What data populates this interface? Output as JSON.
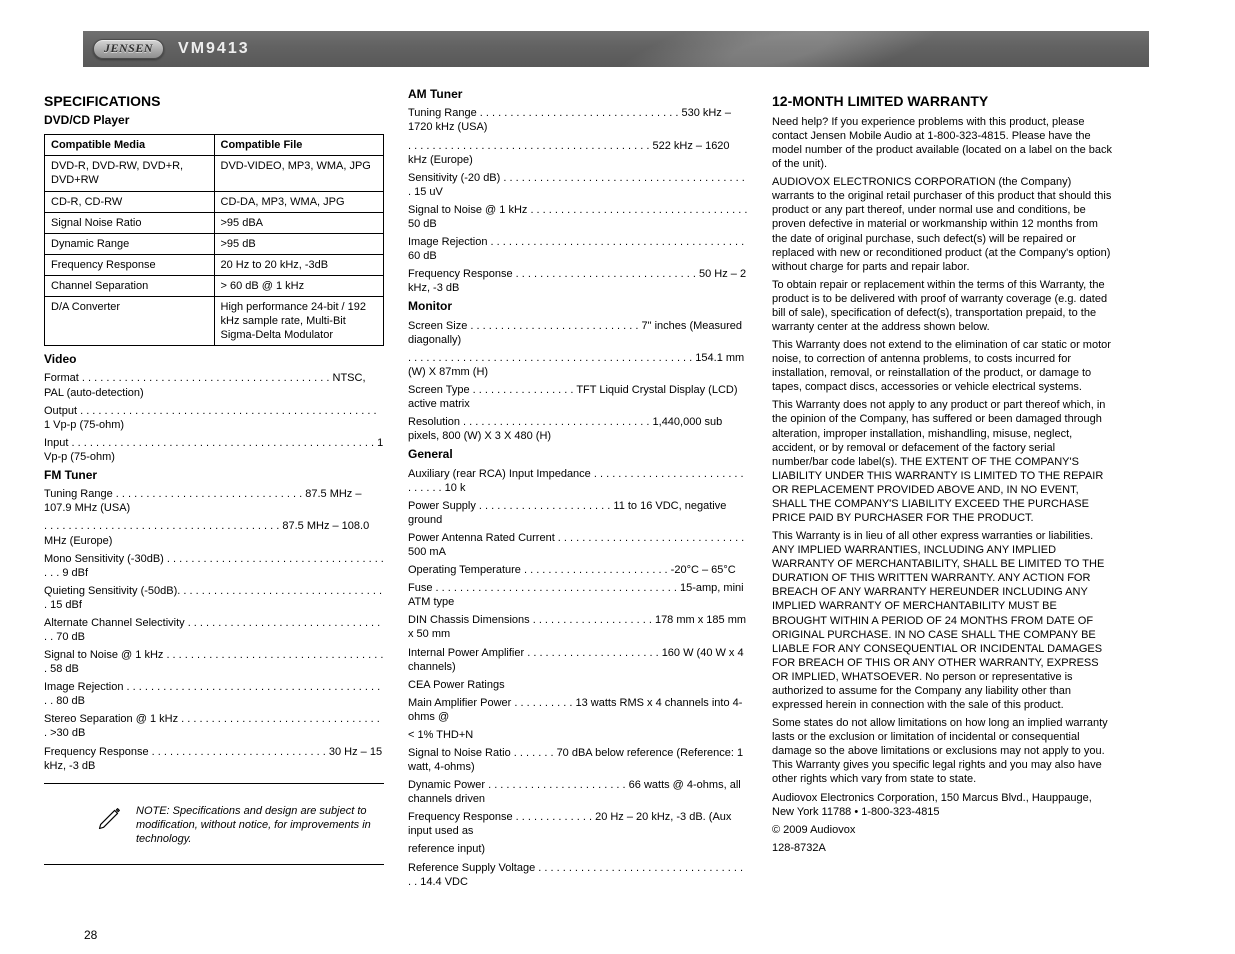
{
  "header": {
    "brand": "JENSEN",
    "model": "VM9413"
  },
  "col1": {
    "h1_a": "SPECIFICATIONS",
    "h1_b": "DVD/CD Player",
    "table": {
      "h1": "Compatible Media",
      "h2": "Compatible File",
      "row1a": "DVD-R, DVD-RW, DVD+R, DVD+RW",
      "row1b": "DVD-VIDEO, MP3, WMA, JPG",
      "row2a": "CD-R, CD-RW",
      "row2b": "CD-DA, MP3, WMA, JPG",
      "row3a": "Signal Noise Ratio",
      "row3b": ">95 dBA",
      "row4a": "Dynamic Range",
      "row4b": ">95 dB",
      "row5a": "Frequency Response",
      "row5b": "20 Hz to 20 kHz, -3dB",
      "row6a": "Channel Separation",
      "row6b": "> 60 dB @ 1 kHz",
      "row7a": "D/A Converter",
      "row7b": "High performance 24-bit / 192 kHz sample rate, Multi-Bit Sigma-Delta Modulator"
    },
    "video_h": "Video",
    "video": [
      "Format . . . . . . . . . . . . . . . . . . . . . . . . . . . . . . . . . . . . . . . . .  NTSC, PAL (auto-detection)",
      "Output . . . . . . . . . . . . . . . . . . . . . . . . . . . . . . . . . . . . . . . . . . . . . . . . .  1 Vp-p (75-ohm)",
      "Input . . . . . . . . . . . . . . . . . . . . . . . . . . . . . . . . . . . . . . . . . . . . . . . . . .  1 Vp-p (75-ohm)"
    ],
    "fm_h": "FM Tuner",
    "fm": [
      "Tuning Range  . . . . . . . . . . . . . . . . . . . . . . . . . . . . . . .  87.5 MHz – 107.9 MHz (USA)",
      ". . . . . . . . . . . . . . . . . . . . . . . . . . . . . . . . . . . . . . .  87.5 MHz – 108.0 MHz (Europe)",
      "Mono Sensitivity (-30dB) . . . . . . . . . . . . . . . . . . . . . . . . . . . . . . . . . . . . . . .  9 dBf",
      "Quieting Sensitivity (-50dB). . . . . . . . . . . . . . . . . . . . . . . . . . . . . . . . . . .  15 dBf",
      "Alternate Channel Selectivity . . . . . . . . . . . . . . . . . . . . . . . . . . . . . . . . . .  70 dB",
      "Signal to Noise @ 1 kHz . . . . . . . . . . . . . . . . . . . . . . . . . . . . . . . . . . . . .  58 dB",
      "Image Rejection . . . . . . . . . . . . . . . . . . . . . . . . . . . . . . . . . . . . . . . . . . . .  80 dB",
      "Stereo Separation @ 1 kHz  . . . . . . . . . . . . . . . . . . . . . . . . . . . . . . . . . .  >30 dB",
      "Frequency Response  . . . . . . . . . . . . . . . . . . . . . . . . . . . . .  30 Hz – 15 kHz, -3 dB"
    ],
    "note": "NOTE:   Specifications and design are subject to modification, without notice, for improvements in technology."
  },
  "col2": {
    "am_h": "AM Tuner",
    "am": [
      "Tuning Range  . . . . . . . . . . . . . . . . . . . . . . . . . . . . . . . . .  530 kHz – 1720 kHz (USA)",
      ". . . . . . . . . . . . . . . . . . . . . . . . . . . . . . . . . . . . . . . .  522 kHz – 1620 kHz (Europe)",
      "Sensitivity (-20 dB) . . . . . . . . . . . . . . . . . . . . . . . . . . . . . . . . . . . . . . . . .  15 uV",
      "Signal to Noise @ 1 kHz . . . . . . . . . . . . . . . . . . . . . . . . . . . . . . . . . . . .  50 dB",
      "Image Rejection . . . . . . . . . . . . . . . . . . . . . . . . . . . . . . . . . . . . . . . . . .  60 dB",
      "Frequency Response  . . . . . . . . . . . . . . . . . . . . . . . . . . . . . .  50 Hz – 2 kHz, -3 dB"
    ],
    "mon_h": "Monitor",
    "mon": [
      "Screen Size  . . . . . . . . . . . . . . . . . . . . . . . . . . . .  7\" inches (Measured diagonally)",
      ". . . . . . . . . . . . . . . . . . . . . . . . . . . . . . . . . . . . . . . . . . . . . . .  154.1 mm (W) X 87mm (H)",
      "Screen Type . . . . . . . . . . . . . . . . .  TFT Liquid Crystal Display (LCD) active matrix",
      "Resolution . . . . . . . . . . . . . . . . . . . . . . . . . . . . . . . 1,440,000 sub pixels, 800 (W) X 3 X 480 (H)"
    ],
    "gen_h": "General",
    "gen": [
      "Auxiliary (rear RCA) Input Impedance . . . . . . . . . . . . . . . . . . . . . . . . . . . . . . . 10 k",
      "Power Supply  . . . . . . . . . . . . . . . . . . . . . .  11 to 16 VDC, negative ground",
      "Power Antenna Rated Current . . . . . . . . . . . . . . . . . . . . . . . . . . . . . . . 500 mA",
      "Operating Temperature  . . . . . . . . . . . . . . . . . . . . . . . .  -20°C – 65°C",
      "Fuse  . . . . . . . . . . . . . . . . . . . . . . . . . . . . . . . . . . . . . . . .  15-amp, mini ATM type",
      "DIN Chassis Dimensions . . . . . . . . . . . . . . . . . . . .  178 mm x 185 mm x 50 mm",
      "Internal Power Amplifier . . . . . . . . . . . . . . . . . . . . . .  160 W (40 W x 4 channels)",
      "CEA Power Ratings",
      "Main Amplifier Power  . . . . . . . . . .  13 watts RMS x 4 channels into 4-ohms @",
      "   < 1% THD+N",
      "Signal to Noise Ratio  . . . . . . .  70 dBA below reference (Reference: 1 watt, 4-ohms)",
      "Dynamic Power  . . . . . . . . . . . . . . . . . . . . . . .  66 watts @ 4-ohms, all channels driven",
      "Frequency Response . . . . . . . . . . . . .  20 Hz – 20 kHz, -3 dB. (Aux input used as",
      "   reference input)",
      "Reference Supply Voltage . . . . . . . . . . . . . . . . . . . . . . . . . . . . . . . . . . . . 14.4 VDC"
    ]
  },
  "col3": {
    "war_h": "12-MONTH LIMITED WARRANTY",
    "needhelp": "Need help? If you experience problems with this product, please contact Jensen Mobile Audio at 1-800-323-4815. Please have the model number of the product available (located on a label on the back of the unit).",
    "body": [
      "AUDIOVOX ELECTRONICS CORPORATION (the Company) warrants to the original retail purchaser of this product that should this product or any part thereof, under normal use and conditions, be proven defective in material or workmanship within 12 months from the date of original purchase, such defect(s) will be repaired or replaced with new or reconditioned product (at the Company's option) without charge for parts and repair labor.",
      "To obtain repair or replacement within the terms of this Warranty, the product is to be delivered with proof of warranty coverage (e.g. dated bill of sale), specification of defect(s), transportation prepaid, to the warranty center at the address shown below.",
      "This Warranty does not extend to the elimination of car static or motor noise, to correction of antenna problems, to costs incurred for installation, removal, or reinstallation of the product, or damage to tapes, compact discs, accessories or vehicle electrical systems.",
      "This Warranty does not apply to any product or part thereof which, in the opinion of the Company, has suffered or been damaged through alteration, improper installation, mishandling, misuse, neglect, accident, or by removal or defacement of the factory serial number/bar code label(s). THE EXTENT OF THE COMPANY'S LIABILITY UNDER THIS WARRANTY IS LIMITED TO THE REPAIR OR REPLACEMENT PROVIDED ABOVE AND, IN NO EVENT, SHALL THE COMPANY'S LIABILITY EXCEED THE PURCHASE PRICE PAID BY PURCHASER FOR THE PRODUCT.",
      "This Warranty is in lieu of all other express warranties or liabilities. ANY IMPLIED WARRANTIES, INCLUDING ANY IMPLIED WARRANTY OF MERCHANTABILITY, SHALL BE LIMITED TO THE DURATION OF THIS WRITTEN WARRANTY. ANY ACTION FOR BREACH OF ANY WARRANTY HEREUNDER INCLUDING ANY IMPLIED WARRANTY OF MERCHANTABILITY MUST BE BROUGHT WITHIN A PERIOD OF 24 MONTHS FROM DATE OF ORIGINAL PURCHASE. IN NO CASE SHALL THE COMPANY BE LIABLE FOR ANY CONSEQUENTIAL OR INCIDENTAL DAMAGES FOR BREACH OF THIS OR ANY OTHER WARRANTY, EXPRESS OR IMPLIED, WHATSOEVER. No person or representative is authorized to assume for the Company any liability other than expressed herein in connection with the sale of this product.",
      "Some states do not allow limitations on how long an implied warranty lasts or the exclusion or limitation of incidental or consequential damage so the above limitations or exclusions may not apply to you. This Warranty gives you specific legal rights and you may also have other rights which vary from state to state.",
      "Audiovox Electronics Corporation, 150 Marcus Blvd., Hauppauge, New York 11788 • 1-800-323-4815",
      "© 2009 Audiovox",
      "128-8732A"
    ]
  },
  "page_number": "28"
}
